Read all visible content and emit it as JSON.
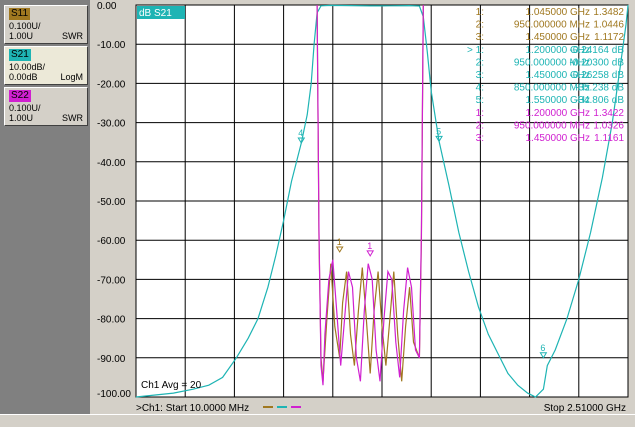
{
  "traces": [
    {
      "name": "S11",
      "line1": "0.100U/",
      "line2": "1.00U",
      "format": "SWR",
      "color": "#a07820",
      "selected": false
    },
    {
      "name": "S21",
      "line1": "10.00dB/",
      "line2": "0.00dB",
      "format": "LogM",
      "color": "#1eb4b4",
      "selected": true
    },
    {
      "name": "S22",
      "line1": "0.100U/",
      "line2": "1.00U",
      "format": "SWR",
      "color": "#d020d0",
      "selected": false
    }
  ],
  "plot": {
    "active_trace_label": "dB S21",
    "y_tick_labels": [
      "0.00",
      "-10.00",
      "-20.00",
      "-30.00",
      "-40.00",
      "-50.00",
      "-60.00",
      "-70.00",
      "-80.00",
      "-90.00",
      "-100.00"
    ],
    "channel_overlay": "Ch1 Avg = 20",
    "start_label": ">Ch1: Start  10.0000 MHz",
    "stop_label": "Stop  2.51000 GHz",
    "colors": {
      "background": "#ffffff",
      "grid": "#000000",
      "s11": "#a07820",
      "s21": "#1eb4b4",
      "s22": "#d020d0"
    }
  },
  "markers": [
    {
      "idx": "1:",
      "freq": "1.045000 GHz",
      "value": "1.3482",
      "color": "#a07820"
    },
    {
      "idx": "2:",
      "freq": "950.000000 MHz",
      "value": "1.0446",
      "color": "#a07820"
    },
    {
      "idx": "3:",
      "freq": "1.450000 GHz",
      "value": "1.1172",
      "color": "#a07820"
    },
    {
      "idx": "> 1:",
      "freq": "1.200000 GHz",
      "value": "-0.24164 dB",
      "color": "#1eb4b4"
    },
    {
      "idx": "2:",
      "freq": "950.000000 MHz",
      "value": "-0.20300 dB",
      "color": "#1eb4b4"
    },
    {
      "idx": "3:",
      "freq": "1.450000 GHz",
      "value": "-0.26258 dB",
      "color": "#1eb4b4"
    },
    {
      "idx": "4:",
      "freq": "850.000000 MHz",
      "value": "-35.238 dB",
      "color": "#1eb4b4"
    },
    {
      "idx": "5:",
      "freq": "1.550000 GHz",
      "value": "-34.806 dB",
      "color": "#1eb4b4"
    },
    {
      "idx": "1:",
      "freq": "1.200000 GHz",
      "value": "1.3422",
      "color": "#d020d0"
    },
    {
      "idx": "2:",
      "freq": "950.000000 MHz",
      "value": "1.0326",
      "color": "#d020d0"
    },
    {
      "idx": "3:",
      "freq": "1.450000 GHz",
      "value": "1.1161",
      "color": "#d020d0"
    }
  ],
  "chart_data": {
    "type": "line",
    "x_unit": "GHz",
    "x_range": [
      0.01,
      2.51
    ],
    "y_range": [
      -100,
      0
    ],
    "y_label": "dB S21",
    "grid": true,
    "series": [
      {
        "name": "S21",
        "color": "#1eb4b4",
        "points": [
          [
            0.01,
            -100
          ],
          [
            0.2,
            -99
          ],
          [
            0.3,
            -98
          ],
          [
            0.38,
            -97
          ],
          [
            0.45,
            -95
          ],
          [
            0.52,
            -90
          ],
          [
            0.58,
            -85
          ],
          [
            0.63,
            -80
          ],
          [
            0.68,
            -72
          ],
          [
            0.72,
            -64
          ],
          [
            0.76,
            -55
          ],
          [
            0.8,
            -45
          ],
          [
            0.85,
            -35.2
          ],
          [
            0.88,
            -28
          ],
          [
            0.9,
            -20
          ],
          [
            0.915,
            -10
          ],
          [
            0.93,
            -2
          ],
          [
            0.95,
            -0.2
          ],
          [
            1.0,
            -0.1
          ],
          [
            1.1,
            -0.15
          ],
          [
            1.2,
            -0.24
          ],
          [
            1.3,
            -0.2
          ],
          [
            1.4,
            -0.15
          ],
          [
            1.45,
            -0.26
          ],
          [
            1.47,
            -3
          ],
          [
            1.49,
            -12
          ],
          [
            1.51,
            -22
          ],
          [
            1.55,
            -34.8
          ],
          [
            1.6,
            -46
          ],
          [
            1.65,
            -58
          ],
          [
            1.7,
            -68
          ],
          [
            1.75,
            -77
          ],
          [
            1.8,
            -84
          ],
          [
            1.85,
            -89
          ],
          [
            1.9,
            -94
          ],
          [
            1.95,
            -97
          ],
          [
            2.0,
            -99
          ],
          [
            2.04,
            -100
          ],
          [
            2.08,
            -98
          ],
          [
            2.1,
            -92
          ],
          [
            2.14,
            -88
          ],
          [
            2.2,
            -80
          ],
          [
            2.26,
            -70
          ],
          [
            2.32,
            -58
          ],
          [
            2.38,
            -44
          ],
          [
            2.43,
            -30
          ],
          [
            2.47,
            -16
          ],
          [
            2.5,
            -5
          ],
          [
            2.51,
            0
          ]
        ]
      },
      {
        "name": "S11",
        "color": "#a07820",
        "points": [
          [
            0.93,
            0
          ],
          [
            0.94,
            -60
          ],
          [
            0.95,
            -90
          ],
          [
            0.96,
            -96
          ],
          [
            0.98,
            -80
          ],
          [
            1.0,
            -66
          ],
          [
            1.02,
            -82
          ],
          [
            1.045,
            -90
          ],
          [
            1.06,
            -76
          ],
          [
            1.08,
            -68
          ],
          [
            1.1,
            -84
          ],
          [
            1.12,
            -92
          ],
          [
            1.14,
            -78
          ],
          [
            1.16,
            -67
          ],
          [
            1.18,
            -80
          ],
          [
            1.2,
            -94
          ],
          [
            1.22,
            -78
          ],
          [
            1.24,
            -68
          ],
          [
            1.26,
            -82
          ],
          [
            1.28,
            -92
          ],
          [
            1.3,
            -80
          ],
          [
            1.32,
            -68
          ],
          [
            1.34,
            -84
          ],
          [
            1.36,
            -96
          ],
          [
            1.38,
            -82
          ],
          [
            1.4,
            -72
          ],
          [
            1.42,
            -86
          ],
          [
            1.45,
            -90
          ],
          [
            1.46,
            -60
          ],
          [
            1.47,
            0
          ]
        ]
      },
      {
        "name": "S22",
        "color": "#d020d0",
        "points": [
          [
            0.93,
            0
          ],
          [
            0.94,
            -58
          ],
          [
            0.95,
            -92
          ],
          [
            0.96,
            -97
          ],
          [
            0.97,
            -84
          ],
          [
            0.99,
            -70
          ],
          [
            1.01,
            -65
          ],
          [
            1.03,
            -78
          ],
          [
            1.05,
            -92
          ],
          [
            1.07,
            -80
          ],
          [
            1.09,
            -68
          ],
          [
            1.11,
            -72
          ],
          [
            1.13,
            -90
          ],
          [
            1.15,
            -96
          ],
          [
            1.17,
            -78
          ],
          [
            1.19,
            -66
          ],
          [
            1.21,
            -70
          ],
          [
            1.23,
            -88
          ],
          [
            1.25,
            -96
          ],
          [
            1.27,
            -80
          ],
          [
            1.29,
            -68
          ],
          [
            1.31,
            -70
          ],
          [
            1.33,
            -86
          ],
          [
            1.35,
            -95
          ],
          [
            1.37,
            -78
          ],
          [
            1.39,
            -67
          ],
          [
            1.41,
            -72
          ],
          [
            1.43,
            -88
          ],
          [
            1.45,
            -90
          ],
          [
            1.46,
            -58
          ],
          [
            1.47,
            0
          ]
        ]
      }
    ],
    "markers": [
      {
        "trace": "S21",
        "label": "4",
        "x": 0.85,
        "y": -35.2
      },
      {
        "trace": "S21",
        "label": "5",
        "x": 1.55,
        "y": -34.8
      },
      {
        "trace": "S21",
        "label": "6",
        "x": 2.08,
        "y": -90
      },
      {
        "trace": "S11",
        "label": "1",
        "x": 1.045,
        "y": -63
      },
      {
        "trace": "S22",
        "label": "1",
        "x": 1.2,
        "y": -64
      }
    ]
  }
}
